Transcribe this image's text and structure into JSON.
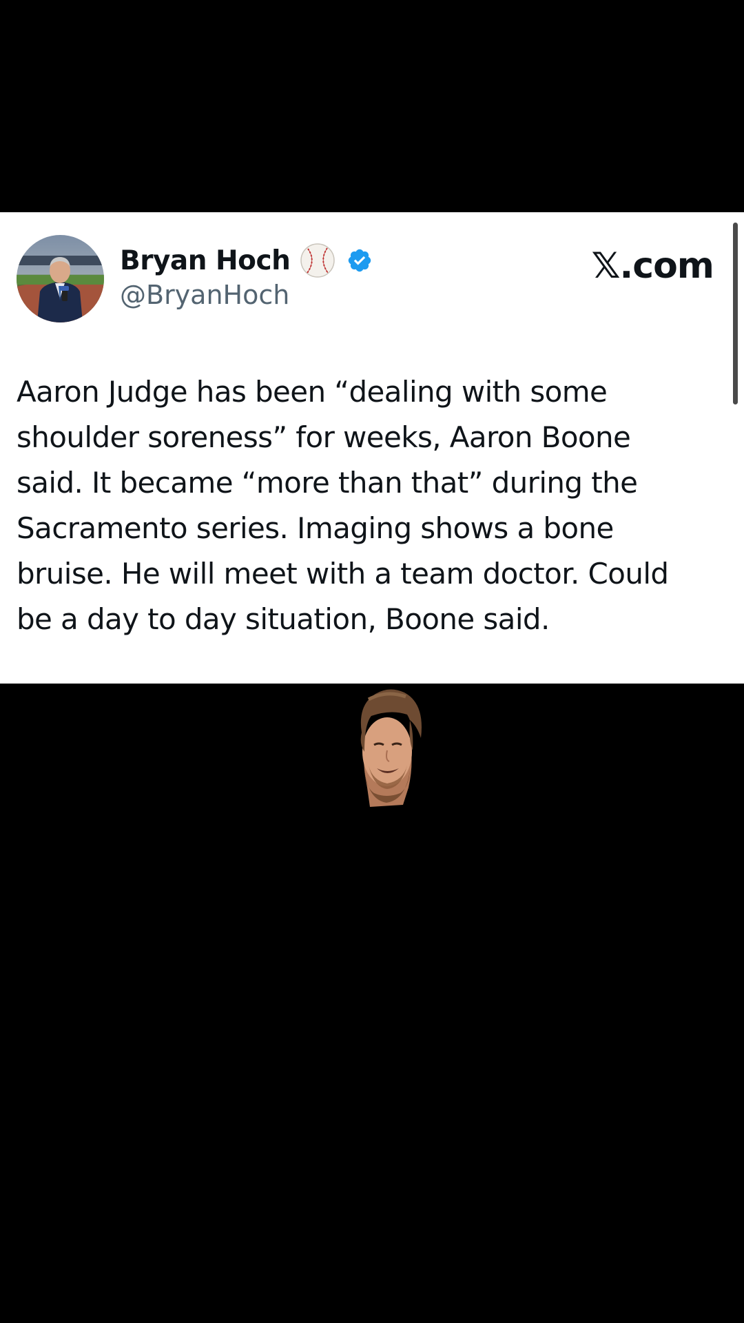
{
  "tweet": {
    "author": {
      "display_name": "Bryan Hoch",
      "handle": "@BryanHoch",
      "avatar_icon": "avatar-reporter-photo",
      "name_emoji_icon": "baseball-icon",
      "verified_icon": "verified-badge-icon"
    },
    "brand": "𝕏.com",
    "text_lines": [
      "Aaron Judge has been “dealing with some",
      "shoulder soreness” for weeks, Aaron Boone",
      "said. It became “more than that” during the",
      "Sacramento series. Imaging shows a bone",
      "bruise. He will meet with a team doctor. Could",
      "be a day to day situation, Boone said."
    ]
  },
  "colors": {
    "background": "#000000",
    "card": "#ffffff",
    "text_primary": "#0f1419",
    "text_secondary": "#536471",
    "verified": "#1d9bf0"
  },
  "overlay": {
    "streamer_icon": "streamer-face-cutout"
  }
}
